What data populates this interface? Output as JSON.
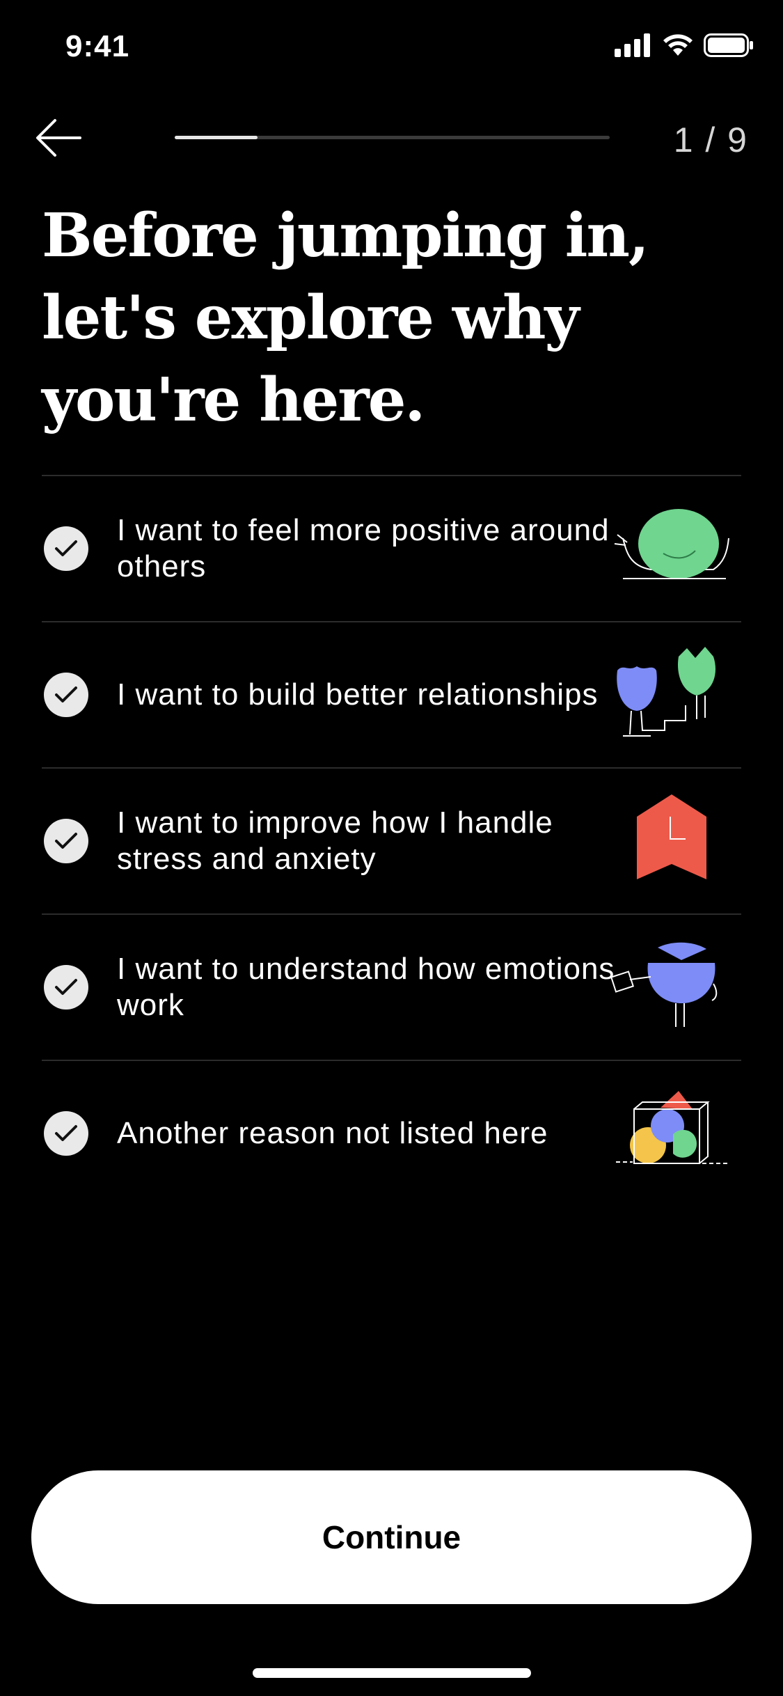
{
  "status_bar": {
    "time": "9:41",
    "icons": [
      "signal-icon",
      "wifi-icon",
      "battery-icon"
    ]
  },
  "nav": {
    "back_icon": "arrow-left-icon",
    "step_counter": "1 / 9",
    "progress_fraction": 0.19
  },
  "page": {
    "title": "Before jumping in, let's explore why you're here."
  },
  "options": [
    {
      "label": "I want to feel more positive around others",
      "checked": true,
      "illustration": "green-blob-illustration"
    },
    {
      "label": "I want to build better relationships",
      "checked": true,
      "illustration": "two-creatures-illustration"
    },
    {
      "label": "I want to improve how I handle stress and anxiety",
      "checked": true,
      "illustration": "clock-banner-illustration"
    },
    {
      "label": "I want to understand how emotions work",
      "checked": true,
      "illustration": "blue-bird-illustration"
    },
    {
      "label": "Another reason not listed here",
      "checked": true,
      "illustration": "shapes-box-illustration"
    }
  ],
  "footer": {
    "continue_label": "Continue"
  },
  "colors": {
    "background": "#000000",
    "text": "#ffffff",
    "divider": "#2c2c2c",
    "check_circle": "#e9e9e9",
    "green": "#6fd58f",
    "blue": "#7d8cf6",
    "red": "#ee5a4a",
    "yellow": "#f4c54a"
  }
}
